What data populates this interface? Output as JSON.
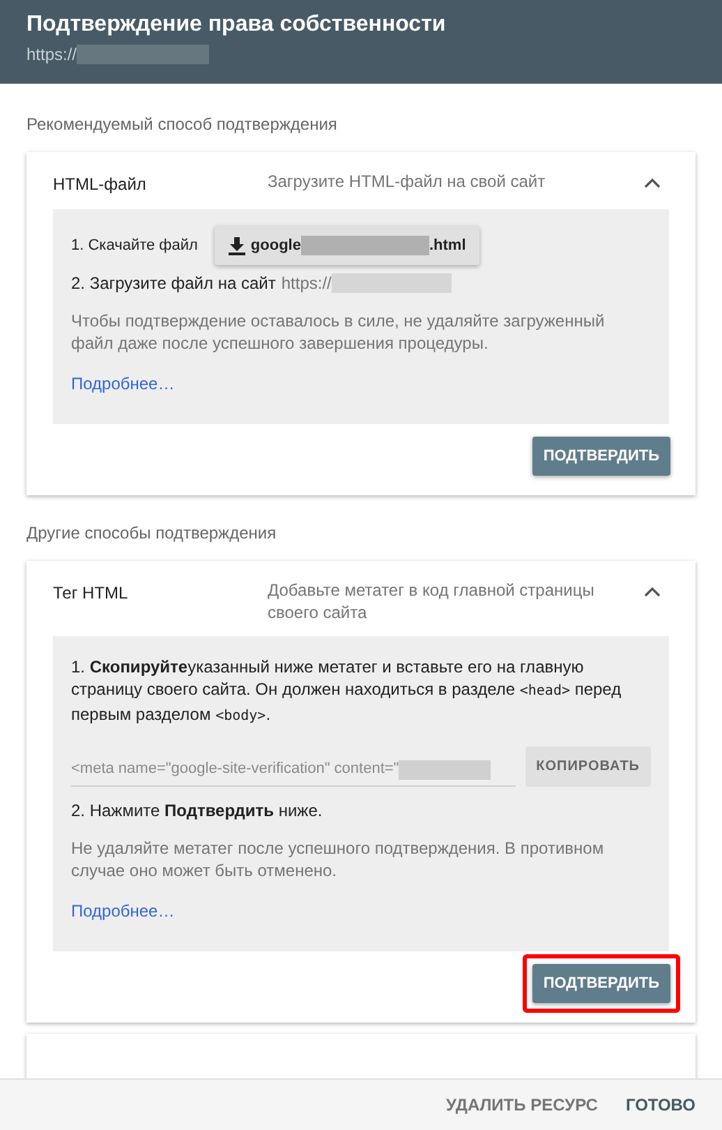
{
  "header": {
    "title": "Подтверждение права собственности",
    "url_prefix": "https://"
  },
  "sections": [
    {
      "label": "Рекомендуемый способ подтверждения",
      "cards": [
        {
          "kind": "file",
          "title": "HTML-файл",
          "summary": "Загрузите HTML-файл на свой сайт",
          "expanded": true,
          "step1_label": "1. Скачайте файл",
          "file_prefix": "google",
          "file_suffix": ".html",
          "step2_label": "2. Загрузите файл на сайт",
          "step2_url": "https://",
          "note": "Чтобы подтверждение оставалось в силе, не удаляйте загруженный файл даже после успешного завершения процедуры.",
          "link": "Подробнее…",
          "button": "ПОДТВЕРДИТЬ",
          "highlighted": false
        }
      ]
    },
    {
      "label": "Другие способы подтверждения",
      "cards": [
        {
          "kind": "meta",
          "title": "Тег HTML",
          "summary": "Добавьте метатег в код главной страницы своего сайта",
          "expanded": true,
          "step1": [
            {
              "kind": "rich",
              "text": "1. **Скопируйте**указанный ниже метатег и вставьте его на главную страницу своего сайта. Он должен находиться в разделе "
            },
            {
              "kind": "code",
              "text": "<head>"
            },
            {
              "kind": "rich",
              "text": " перед первым разделом "
            },
            {
              "kind": "code",
              "text": "<body>"
            },
            {
              "kind": "rich",
              "text": "."
            }
          ],
          "meta_value": "<meta name=\"google-site-verification\" content=\"",
          "copy_button": "КОПИРОВАТЬ",
          "step2": "2. Нажмите **Подтвердить** ниже.",
          "note": "Не удаляйте метатег после успешного подтверждения. В противном случае оно может быть отменено.",
          "link": "Подробнее…",
          "button": "ПОДТВЕРДИТЬ",
          "highlighted": true
        },
        {
          "kind": "collapsed"
        }
      ]
    }
  ],
  "footer": {
    "buttons": [
      "УДАЛИТЬ РЕСУРС",
      "ГОТОВО"
    ]
  }
}
